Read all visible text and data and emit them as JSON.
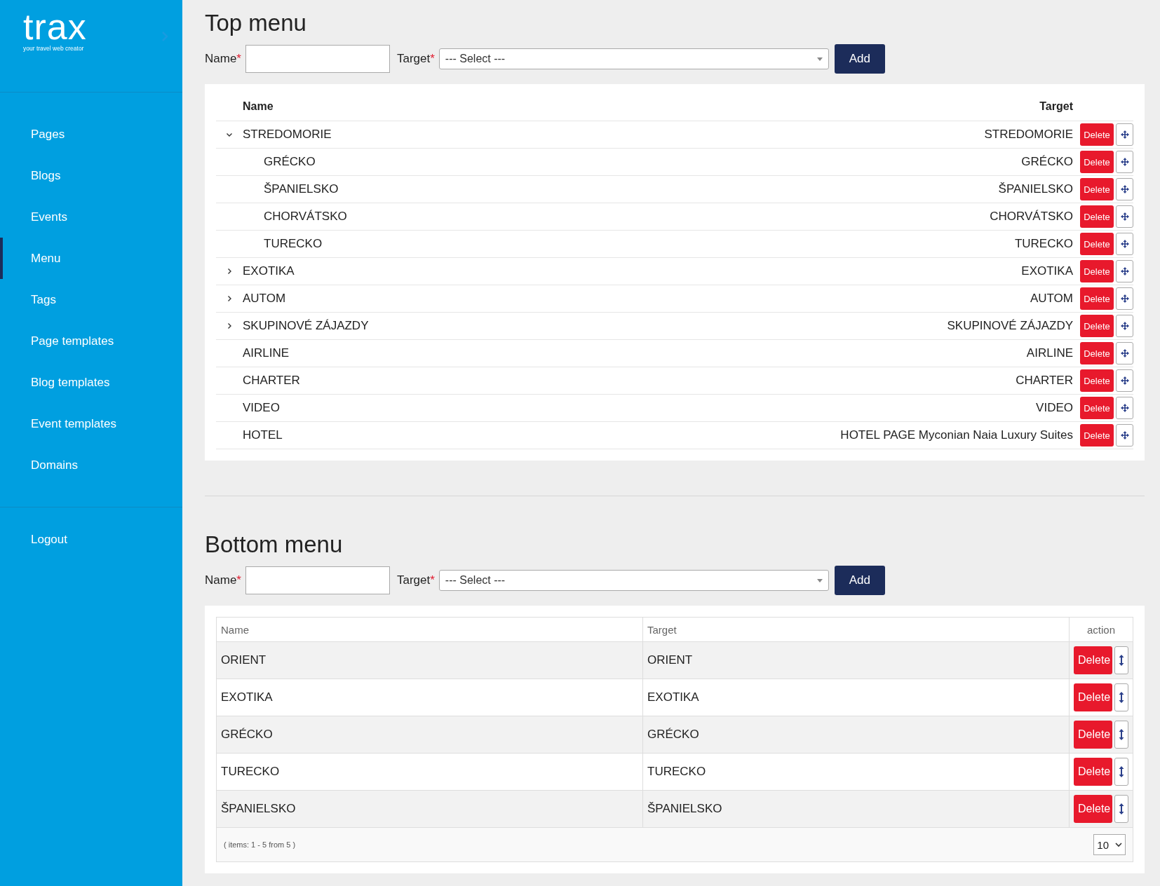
{
  "sidebar": {
    "logo": "trax",
    "tagline": "your travel web creator",
    "items": [
      {
        "label": "Pages",
        "selected": false
      },
      {
        "label": "Blogs",
        "selected": false
      },
      {
        "label": "Events",
        "selected": false
      },
      {
        "label": "Menu",
        "selected": true
      },
      {
        "label": "Tags",
        "selected": false
      },
      {
        "label": "Page templates",
        "selected": false
      },
      {
        "label": "Blog templates",
        "selected": false
      },
      {
        "label": "Event templates",
        "selected": false
      },
      {
        "label": "Domains",
        "selected": false
      }
    ],
    "logout": "Logout"
  },
  "top_menu": {
    "title": "Top menu",
    "name_label": "Name",
    "target_label": "Target",
    "required_mark": "*",
    "select_placeholder": "--- Select ---",
    "add_button": "Add",
    "columns": [
      "Name",
      "Target"
    ],
    "items": [
      {
        "name": "STREDOMORIE",
        "target": "STREDOMORIE",
        "delete": "Delete",
        "expanded": true,
        "children": [
          {
            "name": "GRÉCKO",
            "target": "GRÉCKO",
            "delete": "Delete"
          },
          {
            "name": "ŠPANIELSKO",
            "target": "ŠPANIELSKO",
            "delete": "Delete"
          },
          {
            "name": "CHORVÁTSKO",
            "target": "CHORVÁTSKO",
            "delete": "Delete"
          },
          {
            "name": "TURECKO",
            "target": "TURECKO",
            "delete": "Delete"
          }
        ]
      },
      {
        "name": "EXOTIKA",
        "target": "EXOTIKA",
        "delete": "Delete",
        "expanded": false
      },
      {
        "name": "AUTOM",
        "target": "AUTOM",
        "delete": "Delete",
        "expanded": false
      },
      {
        "name": "SKUPINOVÉ ZÁJAZDY",
        "target": "SKUPINOVÉ ZÁJAZDY",
        "delete": "Delete",
        "expanded": false
      },
      {
        "name": "AIRLINE",
        "target": "AIRLINE",
        "delete": "Delete"
      },
      {
        "name": "CHARTER",
        "target": "CHARTER",
        "delete": "Delete"
      },
      {
        "name": "VIDEO",
        "target": "VIDEO",
        "delete": "Delete"
      },
      {
        "name": "HOTEL",
        "target": "HOTEL PAGE Myconian Naia Luxury Suites",
        "delete": "Delete"
      }
    ]
  },
  "bottom_menu": {
    "title": "Bottom menu",
    "name_label": "Name",
    "target_label": "Target",
    "required_mark": "*",
    "select_placeholder": "--- Select ---",
    "add_button": "Add",
    "columns": [
      "Name",
      "Target",
      "action"
    ],
    "rows": [
      {
        "name": "ORIENT",
        "target": "ORIENT",
        "delete": "Delete"
      },
      {
        "name": "EXOTIKA",
        "target": "EXOTIKA",
        "delete": "Delete"
      },
      {
        "name": "GRÉCKO",
        "target": "GRÉCKO",
        "delete": "Delete"
      },
      {
        "name": "TURECKO",
        "target": "TURECKO",
        "delete": "Delete"
      },
      {
        "name": "ŠPANIELSKO",
        "target": "ŠPANIELSKO",
        "delete": "Delete"
      }
    ],
    "footer": "( items: 1 - 5 from 5 )",
    "page_size": "10"
  }
}
